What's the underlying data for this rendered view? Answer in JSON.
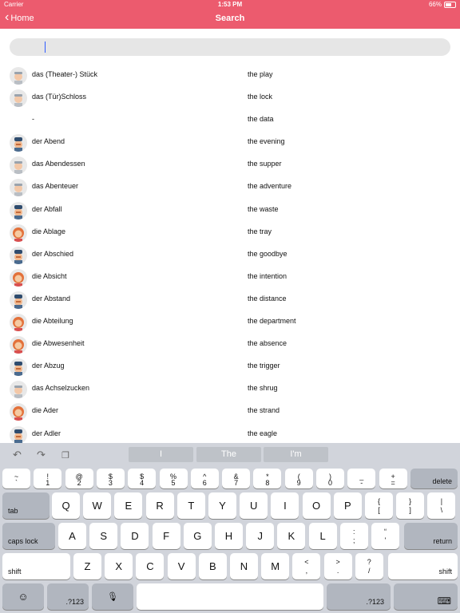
{
  "status": {
    "carrier": "Carrier",
    "time": "1:53 PM",
    "battery": "66%"
  },
  "nav": {
    "back_label": "Home",
    "title": "Search"
  },
  "search": {
    "placeholder": ""
  },
  "rows": [
    {
      "de": "das (Theater-) Stück",
      "en": "the play",
      "avatar": "neutral"
    },
    {
      "de": "das (Tür)Schloss",
      "en": "the lock",
      "avatar": "neutral"
    },
    {
      "de": "-",
      "en": "the data",
      "avatar": "none"
    },
    {
      "de": "der Abend",
      "en": "the evening",
      "avatar": "male"
    },
    {
      "de": "das Abendessen",
      "en": "the supper",
      "avatar": "neutral"
    },
    {
      "de": "das Abenteuer",
      "en": "the adventure",
      "avatar": "neutral"
    },
    {
      "de": "der Abfall",
      "en": "the waste",
      "avatar": "male"
    },
    {
      "de": "die Ablage",
      "en": "the tray",
      "avatar": "female"
    },
    {
      "de": "der Abschied",
      "en": "the goodbye",
      "avatar": "male"
    },
    {
      "de": "die Absicht",
      "en": "the intention",
      "avatar": "female"
    },
    {
      "de": "der Abstand",
      "en": "the distance",
      "avatar": "male"
    },
    {
      "de": "die Abteilung",
      "en": "the department",
      "avatar": "female"
    },
    {
      "de": "die Abwesenheit",
      "en": "the absence",
      "avatar": "female"
    },
    {
      "de": "der Abzug",
      "en": "the trigger",
      "avatar": "male"
    },
    {
      "de": "das Achselzucken",
      "en": "the shrug",
      "avatar": "neutral"
    },
    {
      "de": "die Ader",
      "en": "the strand",
      "avatar": "female"
    },
    {
      "de": "der Adler",
      "en": "the eagle",
      "avatar": "male"
    }
  ],
  "keyboard": {
    "suggestions": [
      "I",
      "The",
      "I'm"
    ],
    "row1": [
      {
        "t": "~",
        "b": "`"
      },
      {
        "t": "!",
        "b": "1"
      },
      {
        "t": "@",
        "b": "2"
      },
      {
        "t": "$",
        "b": "3"
      },
      {
        "t": "$",
        "b": "4"
      },
      {
        "t": "%",
        "b": "5"
      },
      {
        "t": "^",
        "b": "6"
      },
      {
        "t": "&",
        "b": "7"
      },
      {
        "t": "*",
        "b": "8"
      },
      {
        "t": "(",
        "b": "9"
      },
      {
        "t": ")",
        "b": "0"
      },
      {
        "t": "_",
        "b": "-"
      },
      {
        "t": "+",
        "b": "="
      }
    ],
    "row2": [
      {
        "c": "Q"
      },
      {
        "c": "W"
      },
      {
        "c": "E"
      },
      {
        "c": "R"
      },
      {
        "c": "T"
      },
      {
        "c": "Y"
      },
      {
        "c": "U"
      },
      {
        "c": "I"
      },
      {
        "c": "O"
      },
      {
        "c": "P"
      },
      {
        "t": "{",
        "b": "["
      },
      {
        "t": "}",
        "b": "]"
      },
      {
        "t": "|",
        "b": "\\"
      }
    ],
    "row3": [
      {
        "c": "A"
      },
      {
        "c": "S"
      },
      {
        "c": "D"
      },
      {
        "c": "F"
      },
      {
        "c": "G"
      },
      {
        "c": "H"
      },
      {
        "c": "J"
      },
      {
        "c": "K"
      },
      {
        "c": "L"
      },
      {
        "t": ":",
        "b": ";"
      },
      {
        "t": "“",
        "b": "'"
      }
    ],
    "row4": [
      {
        "c": "Z"
      },
      {
        "c": "X"
      },
      {
        "c": "C"
      },
      {
        "c": "V"
      },
      {
        "c": "B"
      },
      {
        "c": "N"
      },
      {
        "c": "M"
      },
      {
        "t": "<",
        "b": ","
      },
      {
        "t": ">",
        "b": "."
      },
      {
        "t": "?",
        "b": "/"
      }
    ],
    "delete": "delete",
    "tab": "tab",
    "caps": "caps lock",
    "return": "return",
    "shift": "shift",
    "num": ".?123"
  }
}
